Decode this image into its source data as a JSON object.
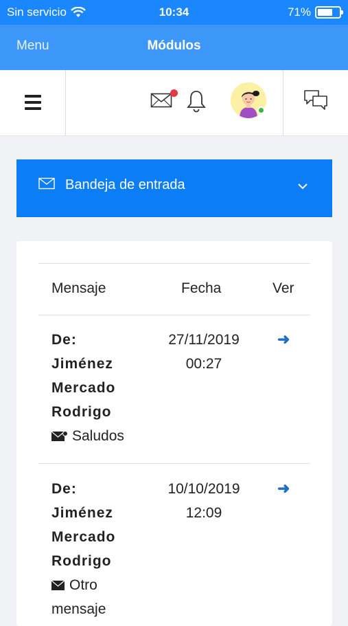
{
  "status_bar": {
    "carrier": "Sin servicio",
    "time": "10:34",
    "battery": "71%",
    "battery_level": 0.71
  },
  "nav": {
    "menu_label": "Menu",
    "title": "Módulos"
  },
  "topbar": {
    "icons": [
      "menu-icon",
      "mail-icon",
      "bell-icon",
      "avatar",
      "chat-icon"
    ],
    "notification_color": "#e23b41",
    "online_color": "#39b54a"
  },
  "inbox": {
    "label": "Bandeja de entrada",
    "color": "#0a7df7"
  },
  "table": {
    "headers": [
      "Mensaje",
      "Fecha",
      "Ver"
    ],
    "rows": [
      {
        "from_lines": [
          "De:",
          "Jiménez",
          "Mercado",
          "Rodrigo"
        ],
        "subject": "Saludos",
        "date": "27/11/2019",
        "time": "00:27",
        "arrow": "➜"
      },
      {
        "from_lines": [
          "De:",
          "Jiménez",
          "Mercado",
          "Rodrigo"
        ],
        "subject_lines": [
          "Otro",
          "mensaje"
        ],
        "date": "10/10/2019",
        "time": "12:09",
        "arrow": "➜"
      }
    ]
  }
}
